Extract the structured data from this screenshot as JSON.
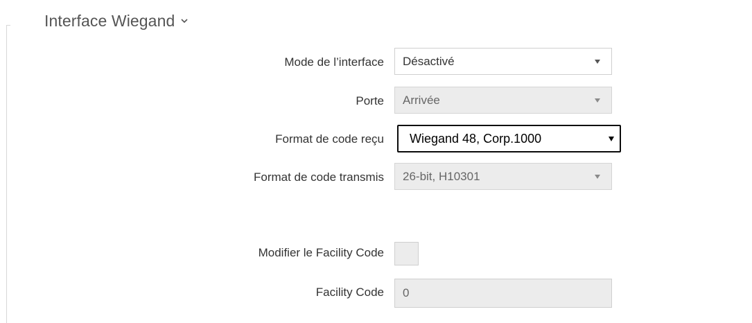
{
  "section": {
    "title": "Interface Wiegand",
    "chevron_icon": "chevron-down-icon"
  },
  "fields": {
    "interface_mode": {
      "label": "Mode de l’interface",
      "value": "Désactivé"
    },
    "port": {
      "label": "Porte",
      "value": "Arrivée"
    },
    "received_code_format": {
      "label": "Format de code reçu",
      "value": "Wiegand 48, Corp.1000"
    },
    "transmitted_code_format": {
      "label": "Format de code transmis",
      "value": "26-bit, H10301"
    },
    "modify_facility_code": {
      "label": "Modifier le Facility Code",
      "checked": false
    },
    "facility_code": {
      "label": "Facility Code",
      "value": "0"
    }
  },
  "colors": {
    "disabled_background": "#ececec",
    "border": "#cfcfcf",
    "text": "#333333"
  }
}
